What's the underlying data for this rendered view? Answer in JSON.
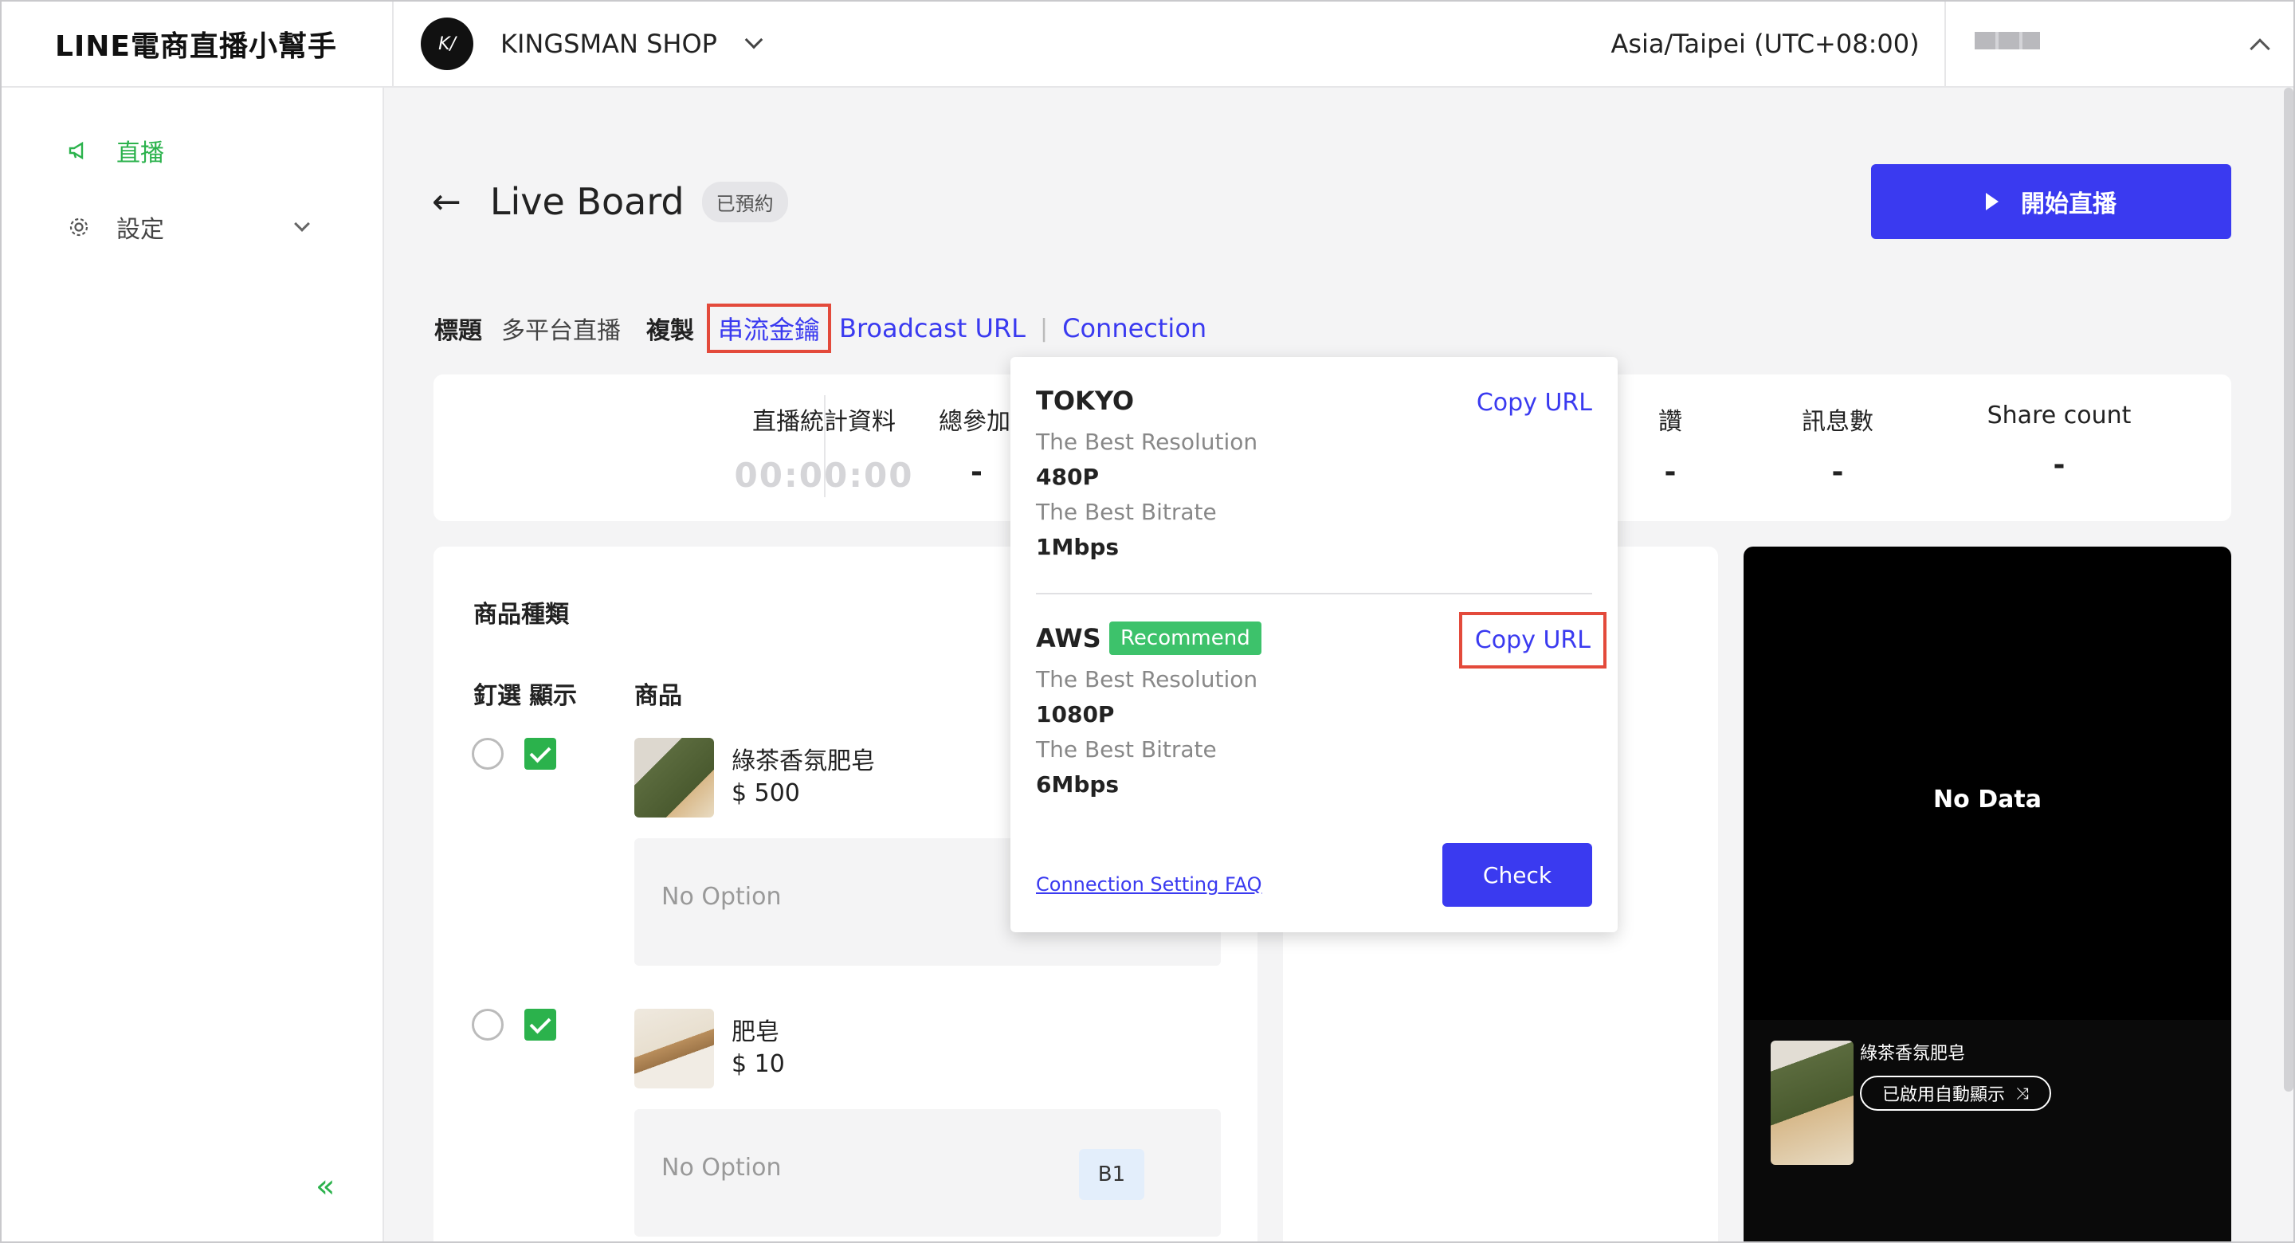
{
  "header": {
    "brand": "LINE電商直播小幫手",
    "shop_avatar_text": "K/",
    "shop_name": "KINGSMAN SHOP",
    "timezone": "Asia/Taipei (UTC+08:00)"
  },
  "sidebar": {
    "items": [
      {
        "label": "直播",
        "icon": "megaphone-icon"
      },
      {
        "label": "設定",
        "icon": "gear-icon"
      }
    ],
    "collapse_icon": "«"
  },
  "page": {
    "back_icon": "←",
    "title": "Live Board",
    "status_badge": "已預約",
    "start_button": "開始直播"
  },
  "meta": {
    "title_label": "標題",
    "title_value": "多平台直播",
    "copy_label": "複製",
    "stream_key": "串流金鑰",
    "broadcast_url": "Broadcast URL",
    "separator": "|",
    "connection": "Connection"
  },
  "stats": [
    {
      "label": "直播統計資料",
      "value": "00:00:00"
    },
    {
      "label": "總參加人",
      "value": "-"
    },
    {
      "label": "讚",
      "value": "-"
    },
    {
      "label": "訊息數",
      "value": "-"
    },
    {
      "label": "Share count",
      "value": "-"
    }
  ],
  "products": {
    "heading": "商品種類",
    "col_pin": "釘選",
    "col_show": "顯示",
    "col_product": "商品",
    "items": [
      {
        "name": "綠茶香氛肥皂",
        "price": "$ 500",
        "option": "No Option",
        "tag": ""
      },
      {
        "name": "肥皂",
        "price": "$ 10",
        "option": "No Option",
        "tag": "B1"
      }
    ]
  },
  "preview": {
    "no_data": "No Data",
    "product_name": "綠茶香氛肥皂",
    "auto_show": "已啟用自動顯示",
    "shuffle_icon": "⤨"
  },
  "connection_popup": {
    "servers": [
      {
        "name": "TOKYO",
        "copy": "Copy URL",
        "resolution_label": "The Best Resolution",
        "resolution": "480P",
        "bitrate_label": "The Best Bitrate",
        "bitrate": "1Mbps",
        "recommend": ""
      },
      {
        "name": "AWS",
        "copy": "Copy URL",
        "resolution_label": "The Best Resolution",
        "resolution": "1080P",
        "bitrate_label": "The Best Bitrate",
        "bitrate": "6Mbps",
        "recommend": "Recommend"
      }
    ],
    "faq": "Connection Setting FAQ",
    "check_button": "Check"
  },
  "colors": {
    "accent": "#3a3af0",
    "brand_green": "#2bb24c",
    "highlight_red": "#e34a3b",
    "recommend_green": "#3dc26b"
  }
}
